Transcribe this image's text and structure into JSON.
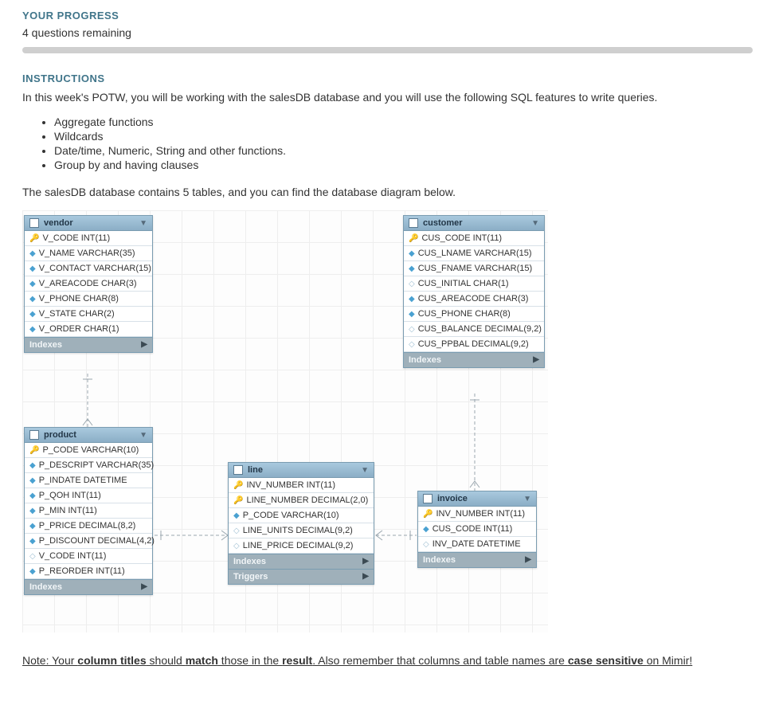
{
  "progress": {
    "title": "YOUR PROGRESS",
    "remaining": "4 questions remaining"
  },
  "instructions": {
    "title": "INSTRUCTIONS",
    "intro": "In this week's POTW, you will be working with the salesDB database and you will use the following SQL features to write queries.",
    "features": [
      "Aggregate functions",
      "Wildcards",
      "Date/time, Numeric, String and other functions.",
      "Group by and having clauses"
    ],
    "tables_sentence": "The salesDB database contains 5 tables, and you can find the database diagram below."
  },
  "note": {
    "prefix": "Note: Your ",
    "bold1": "column titles",
    "mid1": " should ",
    "bold2": "match",
    "mid2": " those in the ",
    "bold3": "result",
    "mid3": ". Also remember that columns and table names are ",
    "bold4": "case sensitive ",
    "suffix": "on Mimir!"
  },
  "diagram": {
    "indexes_label": "Indexes",
    "triggers_label": "Triggers",
    "tables": {
      "vendor": {
        "title": "vendor",
        "cols": [
          {
            "icon": "k",
            "text": "V_CODE INT(11)"
          },
          {
            "icon": "d",
            "text": "V_NAME VARCHAR(35)"
          },
          {
            "icon": "d",
            "text": "V_CONTACT VARCHAR(15)"
          },
          {
            "icon": "d",
            "text": "V_AREACODE CHAR(3)"
          },
          {
            "icon": "d",
            "text": "V_PHONE CHAR(8)"
          },
          {
            "icon": "d",
            "text": "V_STATE CHAR(2)"
          },
          {
            "icon": "d",
            "text": "V_ORDER CHAR(1)"
          }
        ]
      },
      "customer": {
        "title": "customer",
        "cols": [
          {
            "icon": "k",
            "text": "CUS_CODE INT(11)"
          },
          {
            "icon": "d",
            "text": "CUS_LNAME VARCHAR(15)"
          },
          {
            "icon": "d",
            "text": "CUS_FNAME VARCHAR(15)"
          },
          {
            "icon": "o",
            "text": "CUS_INITIAL CHAR(1)"
          },
          {
            "icon": "d",
            "text": "CUS_AREACODE CHAR(3)"
          },
          {
            "icon": "d",
            "text": "CUS_PHONE CHAR(8)"
          },
          {
            "icon": "o",
            "text": "CUS_BALANCE DECIMAL(9,2)"
          },
          {
            "icon": "o",
            "text": "CUS_PPBAL DECIMAL(9,2)"
          }
        ]
      },
      "product": {
        "title": "product",
        "cols": [
          {
            "icon": "k",
            "text": "P_CODE VARCHAR(10)"
          },
          {
            "icon": "d",
            "text": "P_DESCRIPT VARCHAR(35)"
          },
          {
            "icon": "d",
            "text": "P_INDATE DATETIME"
          },
          {
            "icon": "d",
            "text": "P_QOH INT(11)"
          },
          {
            "icon": "d",
            "text": "P_MIN INT(11)"
          },
          {
            "icon": "d",
            "text": "P_PRICE DECIMAL(8,2)"
          },
          {
            "icon": "d",
            "text": "P_DISCOUNT DECIMAL(4,2)"
          },
          {
            "icon": "o",
            "text": "V_CODE INT(11)"
          },
          {
            "icon": "d",
            "text": "P_REORDER INT(11)"
          }
        ]
      },
      "line": {
        "title": "line",
        "cols": [
          {
            "icon": "r",
            "text": "INV_NUMBER INT(11)"
          },
          {
            "icon": "k",
            "text": "LINE_NUMBER DECIMAL(2,0)"
          },
          {
            "icon": "d",
            "text": "P_CODE VARCHAR(10)"
          },
          {
            "icon": "o",
            "text": "LINE_UNITS DECIMAL(9,2)"
          },
          {
            "icon": "o",
            "text": "LINE_PRICE DECIMAL(9,2)"
          }
        ]
      },
      "invoice": {
        "title": "invoice",
        "cols": [
          {
            "icon": "k",
            "text": "INV_NUMBER INT(11)"
          },
          {
            "icon": "d",
            "text": "CUS_CODE INT(11)"
          },
          {
            "icon": "o",
            "text": "INV_DATE DATETIME"
          }
        ]
      }
    }
  }
}
